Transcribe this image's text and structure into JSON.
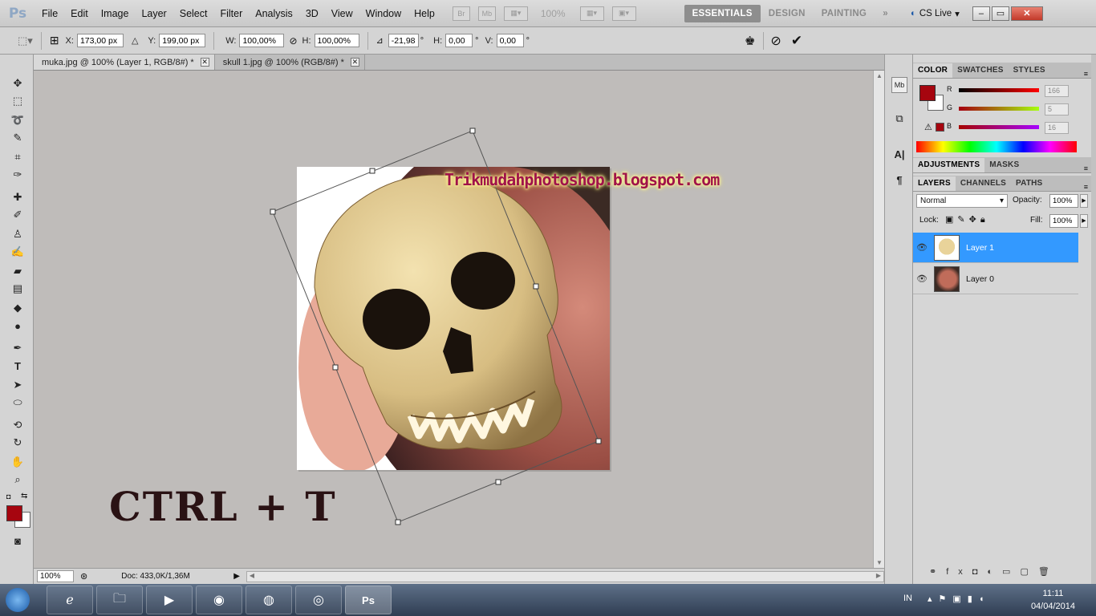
{
  "menubar": {
    "logo": "Ps",
    "items": [
      "File",
      "Edit",
      "Image",
      "Layer",
      "Select",
      "Filter",
      "Analysis",
      "3D",
      "View",
      "Window",
      "Help"
    ],
    "bridge_label": "Br",
    "mini_bridge_label": "Mb",
    "zoom": "100%",
    "workspaces": [
      "ESSENTIALS",
      "DESIGN",
      "PAINTING"
    ],
    "active_workspace": "ESSENTIALS",
    "more_icon": "double-chevron-icon",
    "cs_live": "CS Live",
    "win_minimize": "–",
    "win_restore": "▭",
    "win_close": "✕"
  },
  "options": {
    "x_label": "X:",
    "x_value": "173,00 px",
    "y_label": "Y:",
    "y_value": "199,00 px",
    "w_label": "W:",
    "w_value": "100,00%",
    "h_label": "H:",
    "h_value": "100,00%",
    "angle_value": "-21,98",
    "angle_unit": "°",
    "hskew_label": "H:",
    "hskew_value": "0,00",
    "hskew_unit": "°",
    "vskew_label": "V:",
    "vskew_value": "0,00",
    "vskew_unit": "°"
  },
  "tabs": [
    {
      "label": "muka.jpg @ 100% (Layer 1, RGB/8#) *",
      "active": true
    },
    {
      "label": "skull 1.jpg @ 100% (RGB/8#) *",
      "active": false
    }
  ],
  "canvas": {
    "watermark": "Trikmudahphotoshop.blogspot.com",
    "caption": "CTRL + T",
    "caption_color": "#2a1214"
  },
  "status": {
    "zoom": "100%",
    "doc": "Doc: 433,0K/1,36M"
  },
  "color_panel": {
    "tabs": [
      "COLOR",
      "SWATCHES",
      "STYLES"
    ],
    "fg_color": "#a6050f",
    "bg_color": "#ffffff",
    "r_label": "R",
    "r_value": "166",
    "g_label": "G",
    "g_value": "5",
    "b_label": "B",
    "b_value": "16"
  },
  "adjustments_tabs": [
    "ADJUSTMENTS",
    "MASKS"
  ],
  "layers_panel": {
    "tabs": [
      "LAYERS",
      "CHANNELS",
      "PATHS"
    ],
    "blend_mode": "Normal",
    "opacity_label": "Opacity:",
    "opacity_value": "100%",
    "lock_label": "Lock:",
    "fill_label": "Fill:",
    "fill_value": "100%",
    "layers": [
      {
        "name": "Layer 1",
        "selected": true
      },
      {
        "name": "Layer 0",
        "selected": false
      }
    ]
  },
  "taskbar": {
    "apps": [
      "windows-explorer",
      "internet-explorer",
      "file-manager",
      "media-player",
      "chrome",
      "firefox",
      "globe-app",
      "photoshop"
    ],
    "language": "IN",
    "time": "11:11",
    "date": "04/04/2014"
  }
}
